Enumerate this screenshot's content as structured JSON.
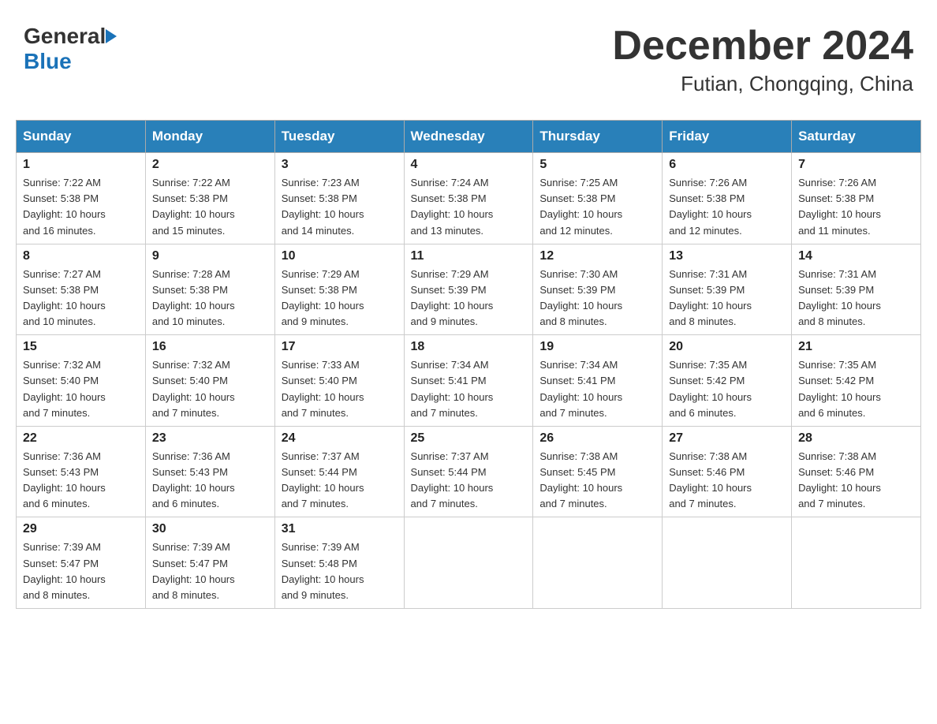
{
  "header": {
    "logo_general": "General",
    "logo_blue": "Blue",
    "month_title": "December 2024",
    "location": "Futian, Chongqing, China"
  },
  "weekdays": [
    "Sunday",
    "Monday",
    "Tuesday",
    "Wednesday",
    "Thursday",
    "Friday",
    "Saturday"
  ],
  "weeks": [
    [
      {
        "day": "1",
        "sunrise": "7:22 AM",
        "sunset": "5:38 PM",
        "daylight": "10 hours and 16 minutes."
      },
      {
        "day": "2",
        "sunrise": "7:22 AM",
        "sunset": "5:38 PM",
        "daylight": "10 hours and 15 minutes."
      },
      {
        "day": "3",
        "sunrise": "7:23 AM",
        "sunset": "5:38 PM",
        "daylight": "10 hours and 14 minutes."
      },
      {
        "day": "4",
        "sunrise": "7:24 AM",
        "sunset": "5:38 PM",
        "daylight": "10 hours and 13 minutes."
      },
      {
        "day": "5",
        "sunrise": "7:25 AM",
        "sunset": "5:38 PM",
        "daylight": "10 hours and 12 minutes."
      },
      {
        "day": "6",
        "sunrise": "7:26 AM",
        "sunset": "5:38 PM",
        "daylight": "10 hours and 12 minutes."
      },
      {
        "day": "7",
        "sunrise": "7:26 AM",
        "sunset": "5:38 PM",
        "daylight": "10 hours and 11 minutes."
      }
    ],
    [
      {
        "day": "8",
        "sunrise": "7:27 AM",
        "sunset": "5:38 PM",
        "daylight": "10 hours and 10 minutes."
      },
      {
        "day": "9",
        "sunrise": "7:28 AM",
        "sunset": "5:38 PM",
        "daylight": "10 hours and 10 minutes."
      },
      {
        "day": "10",
        "sunrise": "7:29 AM",
        "sunset": "5:38 PM",
        "daylight": "10 hours and 9 minutes."
      },
      {
        "day": "11",
        "sunrise": "7:29 AM",
        "sunset": "5:39 PM",
        "daylight": "10 hours and 9 minutes."
      },
      {
        "day": "12",
        "sunrise": "7:30 AM",
        "sunset": "5:39 PM",
        "daylight": "10 hours and 8 minutes."
      },
      {
        "day": "13",
        "sunrise": "7:31 AM",
        "sunset": "5:39 PM",
        "daylight": "10 hours and 8 minutes."
      },
      {
        "day": "14",
        "sunrise": "7:31 AM",
        "sunset": "5:39 PM",
        "daylight": "10 hours and 8 minutes."
      }
    ],
    [
      {
        "day": "15",
        "sunrise": "7:32 AM",
        "sunset": "5:40 PM",
        "daylight": "10 hours and 7 minutes."
      },
      {
        "day": "16",
        "sunrise": "7:32 AM",
        "sunset": "5:40 PM",
        "daylight": "10 hours and 7 minutes."
      },
      {
        "day": "17",
        "sunrise": "7:33 AM",
        "sunset": "5:40 PM",
        "daylight": "10 hours and 7 minutes."
      },
      {
        "day": "18",
        "sunrise": "7:34 AM",
        "sunset": "5:41 PM",
        "daylight": "10 hours and 7 minutes."
      },
      {
        "day": "19",
        "sunrise": "7:34 AM",
        "sunset": "5:41 PM",
        "daylight": "10 hours and 7 minutes."
      },
      {
        "day": "20",
        "sunrise": "7:35 AM",
        "sunset": "5:42 PM",
        "daylight": "10 hours and 6 minutes."
      },
      {
        "day": "21",
        "sunrise": "7:35 AM",
        "sunset": "5:42 PM",
        "daylight": "10 hours and 6 minutes."
      }
    ],
    [
      {
        "day": "22",
        "sunrise": "7:36 AM",
        "sunset": "5:43 PM",
        "daylight": "10 hours and 6 minutes."
      },
      {
        "day": "23",
        "sunrise": "7:36 AM",
        "sunset": "5:43 PM",
        "daylight": "10 hours and 6 minutes."
      },
      {
        "day": "24",
        "sunrise": "7:37 AM",
        "sunset": "5:44 PM",
        "daylight": "10 hours and 7 minutes."
      },
      {
        "day": "25",
        "sunrise": "7:37 AM",
        "sunset": "5:44 PM",
        "daylight": "10 hours and 7 minutes."
      },
      {
        "day": "26",
        "sunrise": "7:38 AM",
        "sunset": "5:45 PM",
        "daylight": "10 hours and 7 minutes."
      },
      {
        "day": "27",
        "sunrise": "7:38 AM",
        "sunset": "5:46 PM",
        "daylight": "10 hours and 7 minutes."
      },
      {
        "day": "28",
        "sunrise": "7:38 AM",
        "sunset": "5:46 PM",
        "daylight": "10 hours and 7 minutes."
      }
    ],
    [
      {
        "day": "29",
        "sunrise": "7:39 AM",
        "sunset": "5:47 PM",
        "daylight": "10 hours and 8 minutes."
      },
      {
        "day": "30",
        "sunrise": "7:39 AM",
        "sunset": "5:47 PM",
        "daylight": "10 hours and 8 minutes."
      },
      {
        "day": "31",
        "sunrise": "7:39 AM",
        "sunset": "5:48 PM",
        "daylight": "10 hours and 9 minutes."
      },
      null,
      null,
      null,
      null
    ]
  ],
  "labels": {
    "sunrise": "Sunrise:",
    "sunset": "Sunset:",
    "daylight": "Daylight:"
  }
}
